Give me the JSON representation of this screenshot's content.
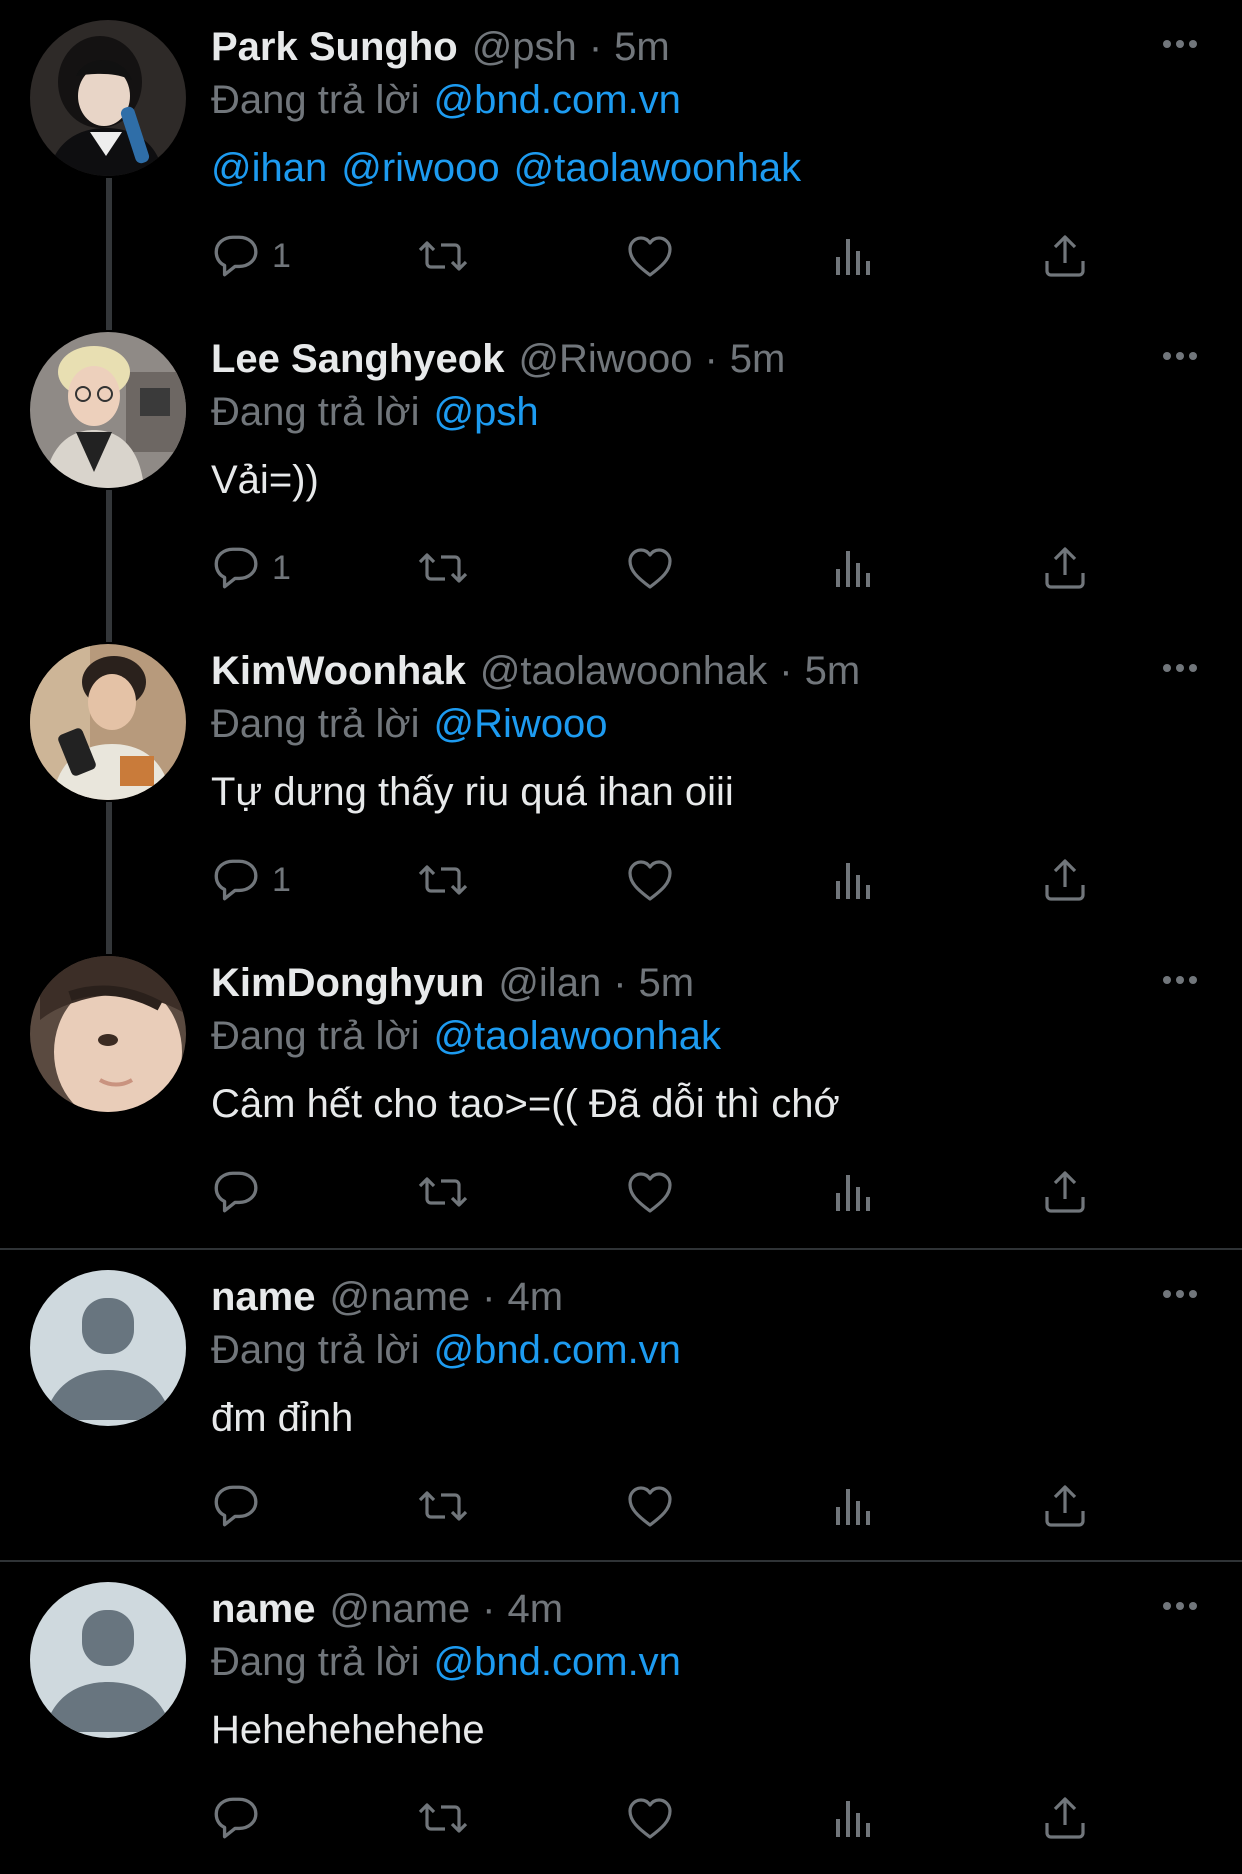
{
  "colors": {
    "background": "#000000",
    "text_primary": "#e7e9ea",
    "text_secondary": "#71767b",
    "accent": "#1d9bf0",
    "divider": "#2f3336"
  },
  "reply_prefix": "Đang trả lời",
  "tweets": [
    {
      "display_name": "Park Sungho",
      "handle": "@psh",
      "separator": "·",
      "time": "5m",
      "reply_target": "@bnd.com.vn",
      "mentions": [
        "@ihan",
        "@riwooo",
        "@taolawoonhak"
      ],
      "text": "",
      "reply_count": "1",
      "avatar_icon": "profile-photo-dark-hair"
    },
    {
      "display_name": "Lee Sanghyeok",
      "handle": "@Riwooo",
      "separator": "·",
      "time": "5m",
      "reply_target": "@psh",
      "text": "Vải=))",
      "reply_count": "1",
      "avatar_icon": "profile-photo-blonde-glasses"
    },
    {
      "display_name": "KimWoonhak",
      "handle": "@taolawoonhak",
      "separator": "·",
      "time": "5m",
      "reply_target": "@Riwooo",
      "text": "Tự dưng thấy riu quá ihan oiii",
      "reply_count": "1",
      "avatar_icon": "profile-photo-phone"
    },
    {
      "display_name": "KimDonghyun",
      "handle": "@ilan",
      "separator": "·",
      "time": "5m",
      "reply_target": "@taolawoonhak",
      "text": "Câm hết cho tao>=(( Đã dỗi thì chớ",
      "reply_count": "",
      "avatar_icon": "profile-photo-closeup"
    },
    {
      "display_name": "name",
      "handle": "@name",
      "separator": "·",
      "time": "4m",
      "reply_target": "@bnd.com.vn",
      "text": "đm đỉnh",
      "reply_count": "",
      "avatar_icon": "default-avatar-icon"
    },
    {
      "display_name": "name",
      "handle": "@name",
      "separator": "·",
      "time": "4m",
      "reply_target": "@bnd.com.vn",
      "text": "Hehehehehehe",
      "reply_count": "",
      "avatar_icon": "default-avatar-icon"
    }
  ]
}
